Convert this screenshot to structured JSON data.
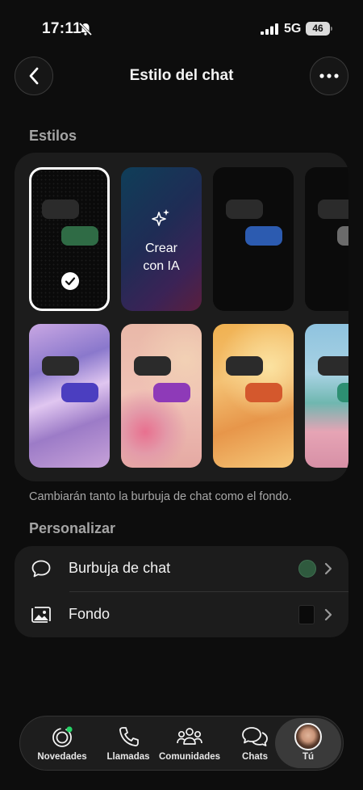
{
  "status_bar": {
    "time": "17:11",
    "network": "5G",
    "battery": "46"
  },
  "header": {
    "title": "Estilo del chat"
  },
  "styles_section": {
    "label": "Estilos",
    "ai_tile_label": "Crear con IA",
    "caption": "Cambiarán tanto la burbuja de chat como el fondo.",
    "tiles": [
      {
        "name": "dark-green",
        "bubble_color": "#2f6b45",
        "selected": true
      },
      {
        "name": "create-with-ai"
      },
      {
        "name": "dark-blue",
        "bubble_color": "#2c5bb0"
      },
      {
        "name": "dark-grey",
        "bubble_color": "#6b6b6b"
      },
      {
        "name": "purple-iridescent",
        "bubble_color": "#4b3ec0"
      },
      {
        "name": "pink-flowers",
        "bubble_color": "#8e3ab8"
      },
      {
        "name": "orange-silk",
        "bubble_color": "#d4582d"
      },
      {
        "name": "beach",
        "bubble_color": "#2d8f72"
      }
    ]
  },
  "customize_section": {
    "label": "Personalizar",
    "rows": [
      {
        "label": "Burbuja de chat",
        "swatch_color": "#2f5a3e"
      },
      {
        "label": "Fondo"
      }
    ]
  },
  "tab_bar": {
    "tabs": [
      {
        "label": "Novedades"
      },
      {
        "label": "Llamadas"
      },
      {
        "label": "Comunidades"
      },
      {
        "label": "Chats"
      },
      {
        "label": "Tú",
        "active": true
      }
    ]
  },
  "colors": {
    "accent_green": "#25d366",
    "background": "#0d0d0d",
    "panel": "#1c1c1c"
  }
}
